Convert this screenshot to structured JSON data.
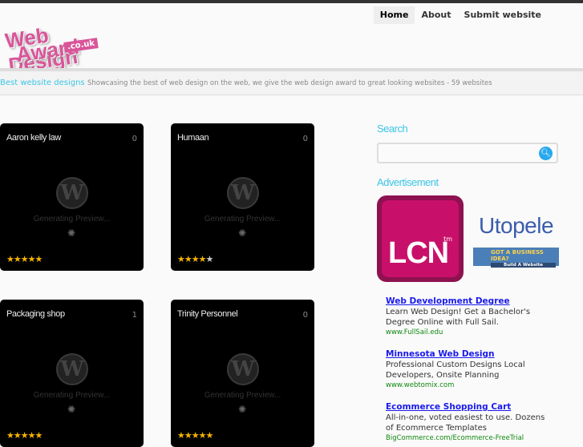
{
  "logo": {
    "line1": "Web Design",
    "line2": "Award",
    "suffix": ".co.uk"
  },
  "nav": [
    {
      "label": "Home",
      "active": true
    },
    {
      "label": "About"
    },
    {
      "label": "Submit website"
    }
  ],
  "tagline": {
    "title": "Best website designs",
    "text": "Showcasing the best of web design on the web, we give the web design award to great looking websites - 59 websites"
  },
  "cards": [
    {
      "title": "Aaron kelly law",
      "count": "0",
      "preview": "Generating Preview...",
      "rating": 4.5
    },
    {
      "title": "Humaan",
      "count": "0",
      "preview": "Generating Preview...",
      "rating": 4
    },
    {
      "title": "Packaging shop",
      "count": "1",
      "preview": "Generating Preview...",
      "rating": 5
    },
    {
      "title": "Trinity Personnel",
      "count": "0",
      "preview": "Generating Preview...",
      "rating": 5
    }
  ],
  "sidebar": {
    "search_heading": "Search",
    "search_value": "",
    "ad_heading": "Advertisement",
    "lcn": {
      "text": "LCN",
      "tm": "tm"
    },
    "utopele": "Utopele",
    "biz_banner": {
      "title": "GOT A BUSINESS IDEA?",
      "button": "Build A Website"
    },
    "text_ads": [
      {
        "title": "Web Development Degree",
        "body": "Learn Web Design! Get a Bachelor's Degree Online with Full Sail.",
        "url": "www.FullSail.edu"
      },
      {
        "title": "Minnesota Web Design",
        "body": "Professional Custom Designs Local Developers, Onsite Planning",
        "url": "www.webtomix.com"
      },
      {
        "title": "Ecommerce Shopping Cart",
        "body": "All-in-one, voted easiest to use. Dozens of Ecommerce Templates",
        "url": "BigCommerce.com/Ecommerce-FreeTrial"
      }
    ]
  },
  "colors": {
    "accent": "#3bc6e6",
    "brand": "#d9559a",
    "link": "#1a1aee"
  }
}
